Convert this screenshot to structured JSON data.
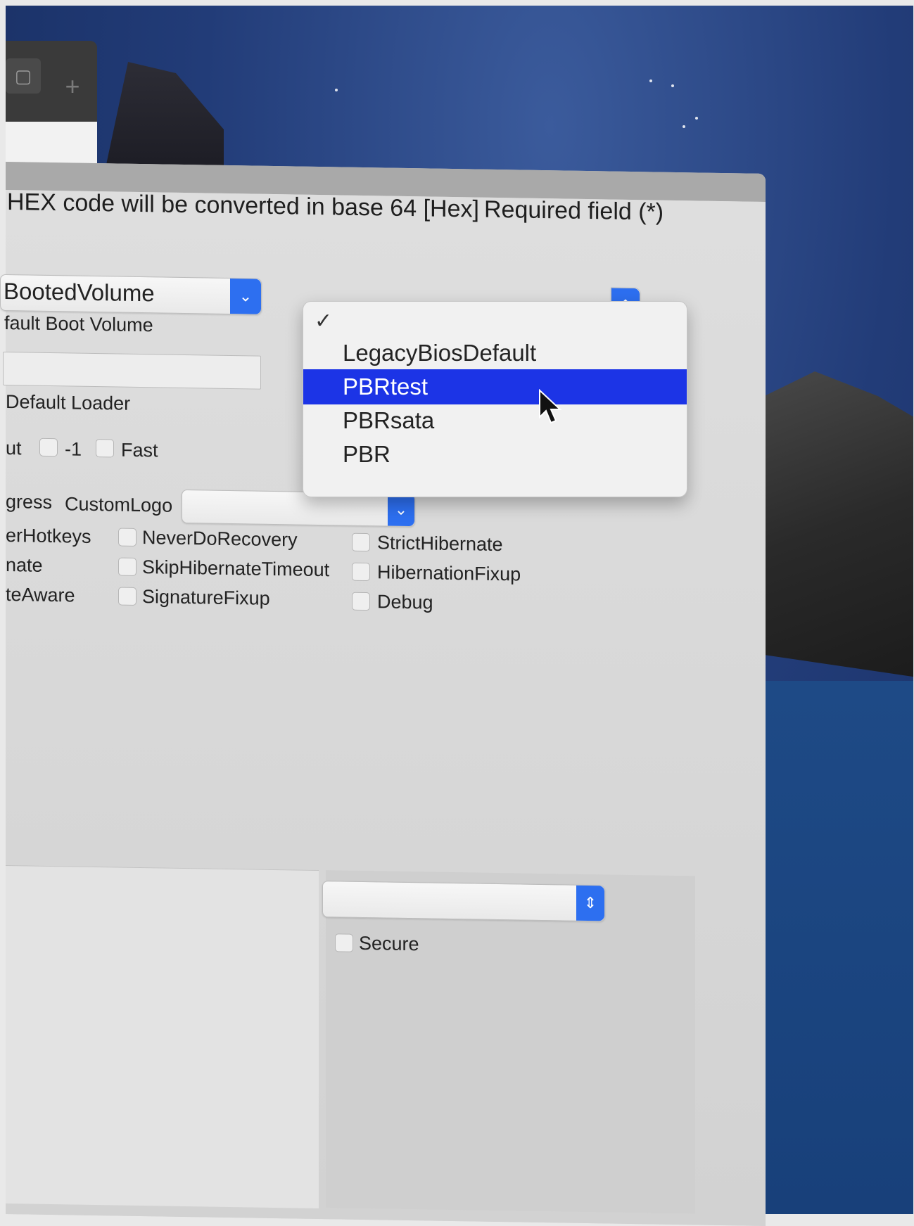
{
  "header": {
    "hex_hint": "HEX code will be converted in base 64 [Hex]",
    "required_hint": "Required field (*)"
  },
  "default_volume": {
    "value": "BootedVolume",
    "label": "fault Boot Volume"
  },
  "default_loader": {
    "label": "Default Loader"
  },
  "timeout_row": {
    "label": "ut",
    "minus_one_label": "-1",
    "fast_label": "Fast"
  },
  "progress_row": {
    "label": "gress",
    "custom_logo_label": "CustomLogo"
  },
  "options": {
    "col_left": [
      "erHotkeys",
      "nate",
      "teAware"
    ],
    "col_mid": [
      "NeverDoRecovery",
      "SkipHibernateTimeout",
      "SignatureFixup"
    ],
    "col_right": [
      "StrictHibernate",
      "HibernationFixup",
      "Debug"
    ]
  },
  "dropdown_menu": {
    "check": "✓",
    "items": [
      "LegacyBiosDefault",
      "PBRtest",
      "PBRsata",
      "PBR"
    ],
    "selected": "PBRtest"
  },
  "bottom": {
    "secure_label": "Secure"
  },
  "icons": {
    "chevron": "⌄",
    "updown": "⇕",
    "plus": "+"
  }
}
